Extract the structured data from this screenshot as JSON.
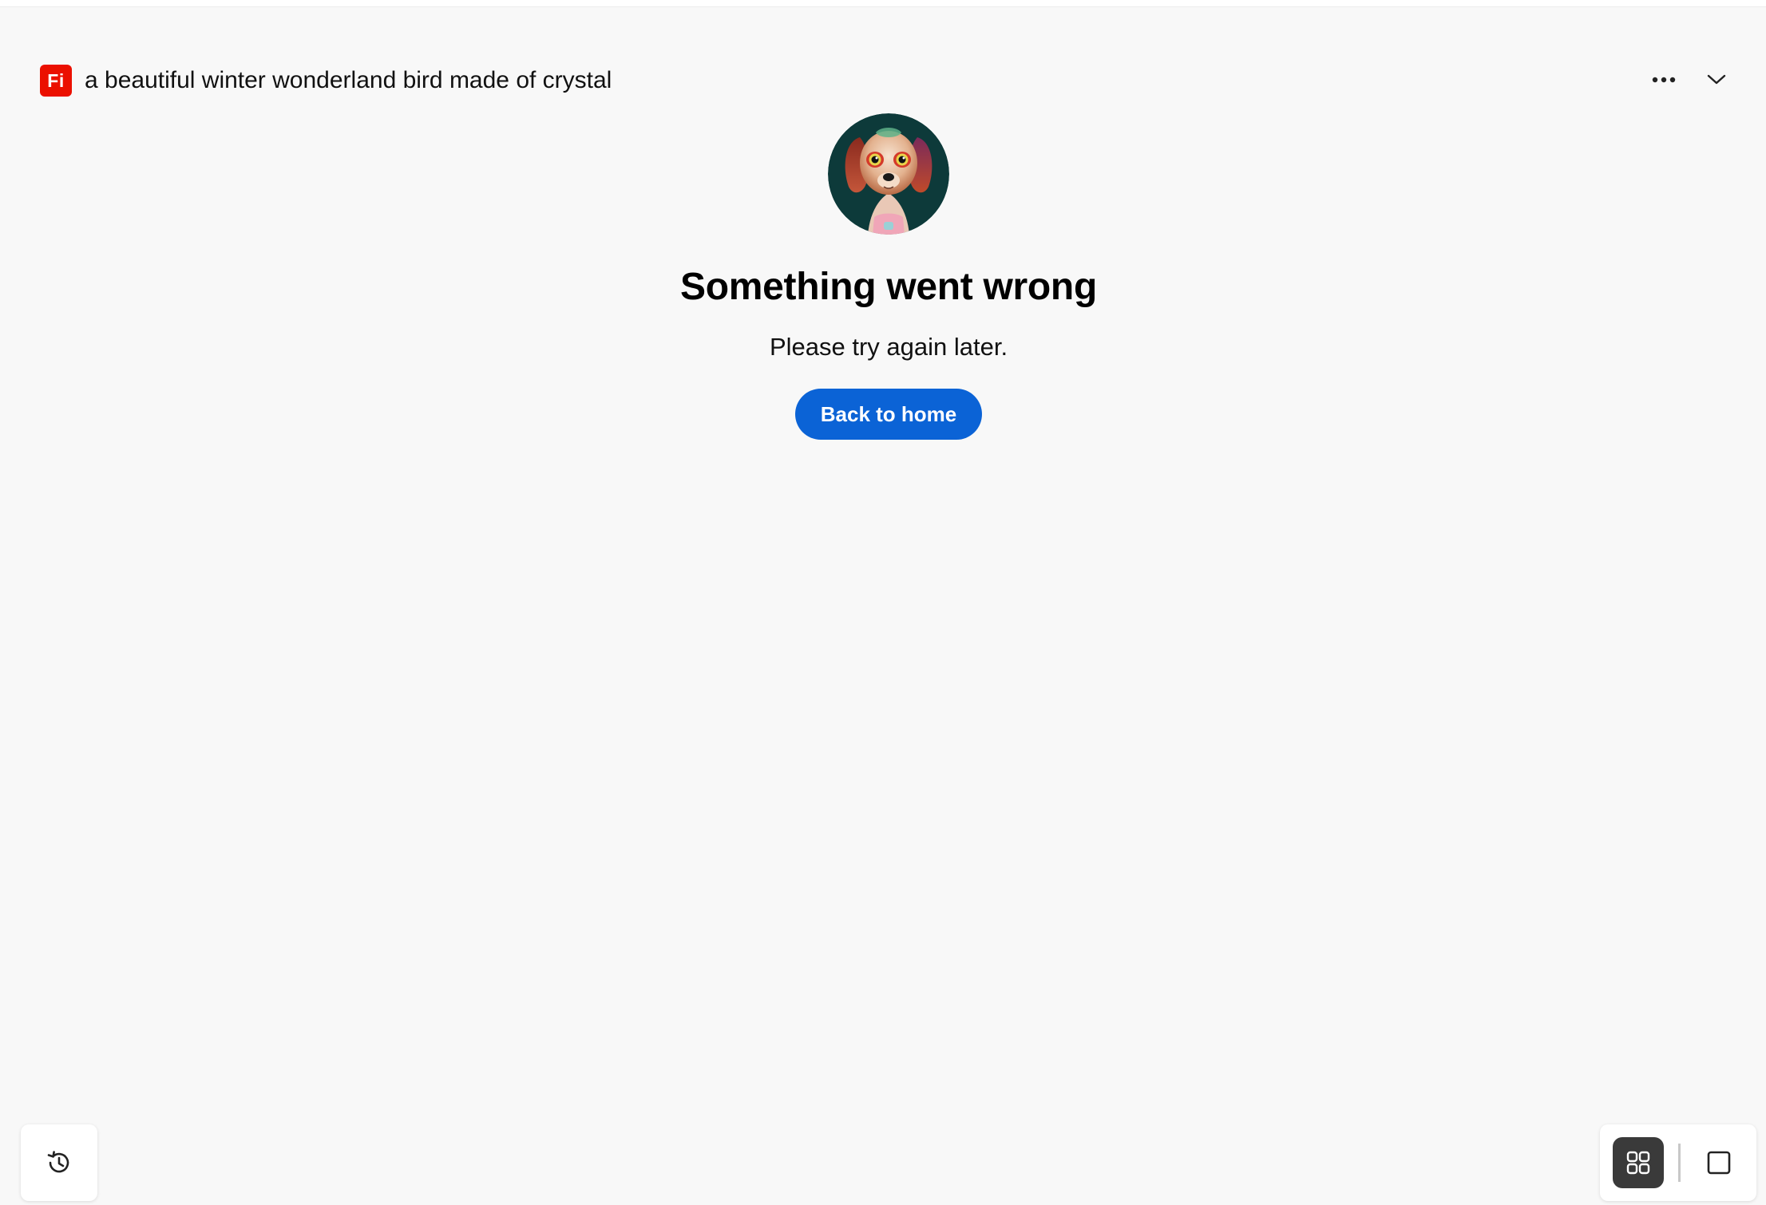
{
  "app": {
    "logo_text": "Fi",
    "brand_color": "#eb1000"
  },
  "header": {
    "prompt_title": "a beautiful winter wonderland bird made of crystal",
    "more_icon": "more-horizontal-icon",
    "collapse_icon": "chevron-down-icon"
  },
  "error": {
    "avatar_icon": "dog-avatar-illustration",
    "title": "Something went wrong",
    "message": "Please try again later.",
    "button_label": "Back to home",
    "button_color": "#0b63d6"
  },
  "footer": {
    "history_icon": "history-icon",
    "view_toggle": {
      "selected": "grid",
      "grid_icon": "grid-view-icon",
      "single_icon": "single-view-icon"
    }
  }
}
